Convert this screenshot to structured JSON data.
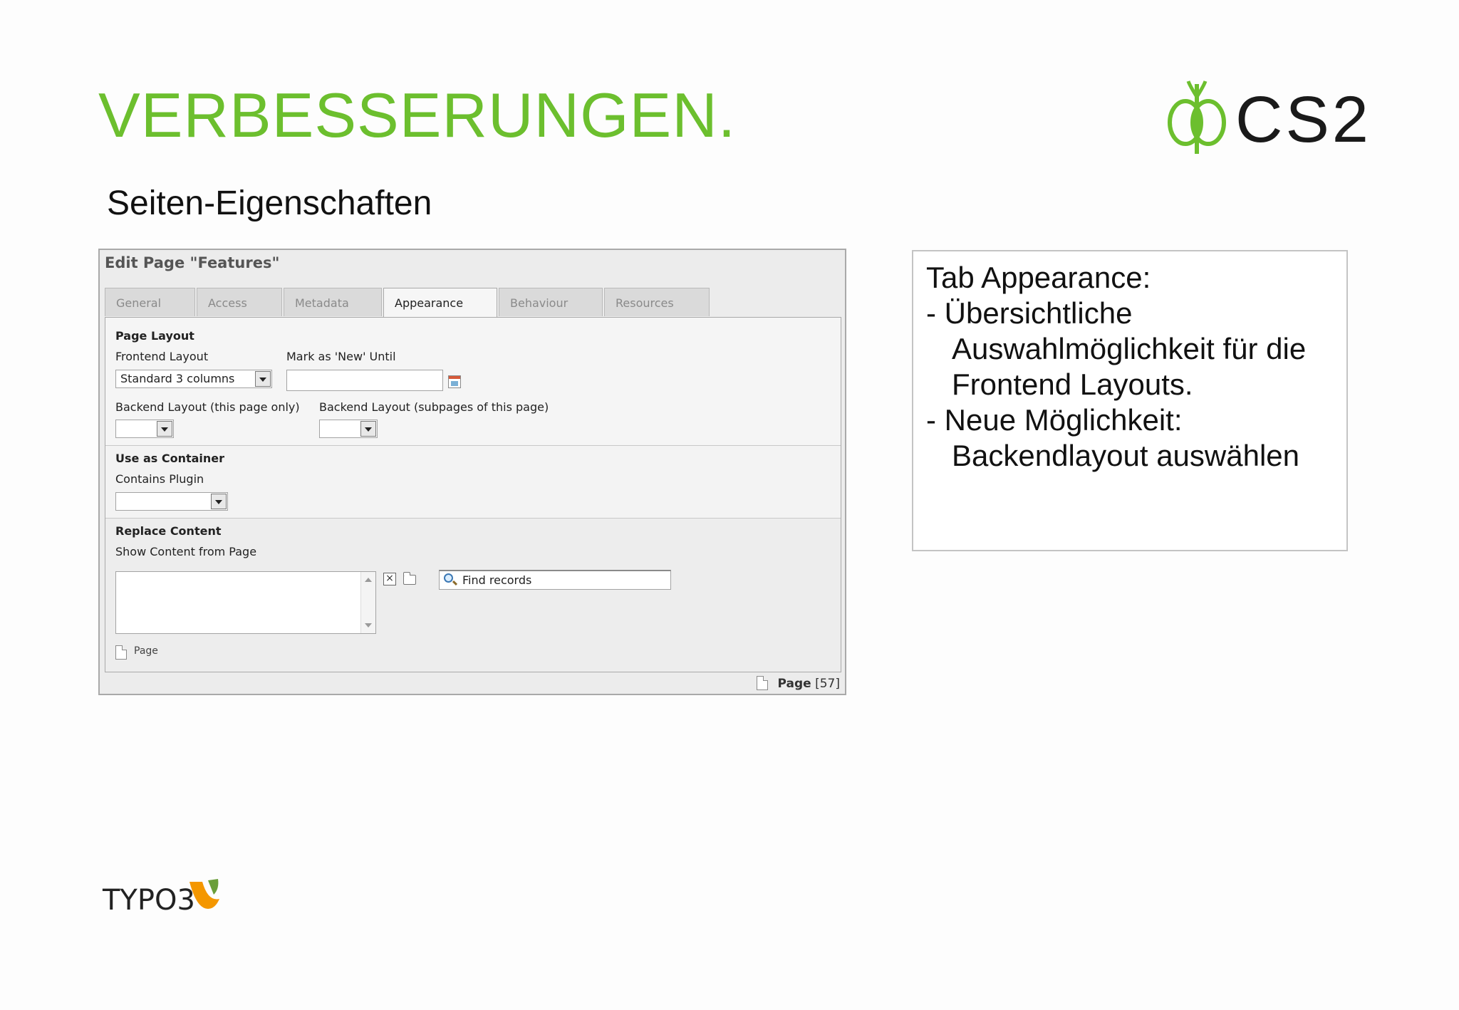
{
  "slide": {
    "title": "VERBESSERUNGEN.",
    "subtitle": "Seiten-Eigenschaften",
    "logo_text": "CS2",
    "footer_logo_text": "TYPO3",
    "title_color": "#6cbf2e"
  },
  "screenshot": {
    "edit_title": "Edit Page \"Features\"",
    "tabs": [
      {
        "label": "General",
        "active": false
      },
      {
        "label": "Access",
        "active": false
      },
      {
        "label": "Metadata",
        "active": false
      },
      {
        "label": "Appearance",
        "active": true
      },
      {
        "label": "Behaviour",
        "active": false
      },
      {
        "label": "Resources",
        "active": false
      }
    ],
    "page_layout": {
      "heading": "Page Layout",
      "frontend_layout_label": "Frontend Layout",
      "frontend_layout_value": "Standard 3 columns",
      "mark_new_label": "Mark as 'New' Until",
      "mark_new_value": "",
      "backend_layout_label": "Backend Layout (this page only)",
      "backend_layout_value": "",
      "backend_layout_sub_label": "Backend Layout (subpages of this page)",
      "backend_layout_sub_value": ""
    },
    "container": {
      "heading": "Use as Container",
      "contains_plugin_label": "Contains Plugin",
      "contains_plugin_value": ""
    },
    "replace_content": {
      "heading": "Replace Content",
      "show_content_label": "Show Content from Page",
      "search_placeholder": "Find records",
      "page_table_label": "Page"
    },
    "footer": {
      "record_type": "Page",
      "record_id": "[57]"
    }
  },
  "info_box": {
    "lines": [
      "Tab Appearance:",
      "- Übersichtliche",
      "Auswahlmöglichkeit für die",
      "Frontend Layouts.",
      "- Neue Möglichkeit:",
      "Backendlayout auswählen"
    ]
  }
}
